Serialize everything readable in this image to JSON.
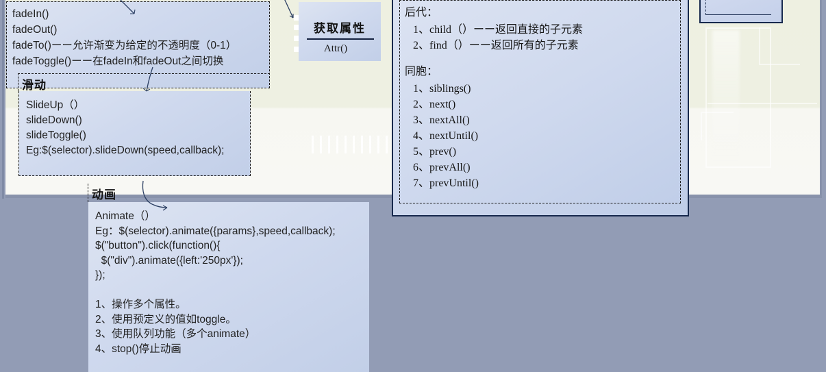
{
  "app": {
    "surface": "powerpoint-slide-editing-canvas",
    "slide_background_color": "#eef0e1",
    "workspace_background_color": "#929cb5",
    "shape_fill_color": "#cfd9ee",
    "shape_border_color": "#17294d"
  },
  "shapes": {
    "fade_box": {
      "name": "fade-effects-textbox",
      "lines": [
        "fadeIn()",
        "fadeOut()",
        "fadeTo()ーー允许渐变为给定的不透明度（0-1）",
        "fadeToggle()ーー在fadeIn和fadeOut之间切换"
      ]
    },
    "slide_section": {
      "title": "滑动",
      "name": "slide-effects-textbox",
      "lines": [
        "SlideUp（）",
        "slideDown()",
        "slideToggle()",
        "Eg:$(selector).slideDown(speed,callback);"
      ]
    },
    "animation_section": {
      "title": "动画",
      "name": "animation-textbox",
      "lines": [
        "Animate（）",
        "Eg：$(selector).animate({params},speed,callback);",
        "$(\"button\").click(function(){",
        "  $(\"div\").animate({left:'250px'});",
        "});",
        "",
        "1、操作多个属性。",
        "2、使用预定义的值如toggle。",
        "3、使用队列功能（多个animate）",
        "4、stop()停止动画"
      ]
    },
    "attr_box": {
      "name": "get-attribute-box",
      "title": "获取属性",
      "subtitle": "Attr()"
    },
    "dom_box": {
      "name": "dom-traversal-box",
      "descendants_label": "后代：",
      "descendants": [
        "1、child（）ーー返回直接的子元素",
        "2、find（）ーー返回所有的子元素"
      ],
      "siblings_label": "同胞：",
      "siblings": [
        "1、siblings()",
        "2、next()",
        "3、nextAll()",
        "4、nextUntil()",
        "5、prev()",
        "6、prevAll()",
        "7、prevUntil()"
      ]
    },
    "mini_box": {
      "name": "small-blue-shape"
    }
  }
}
